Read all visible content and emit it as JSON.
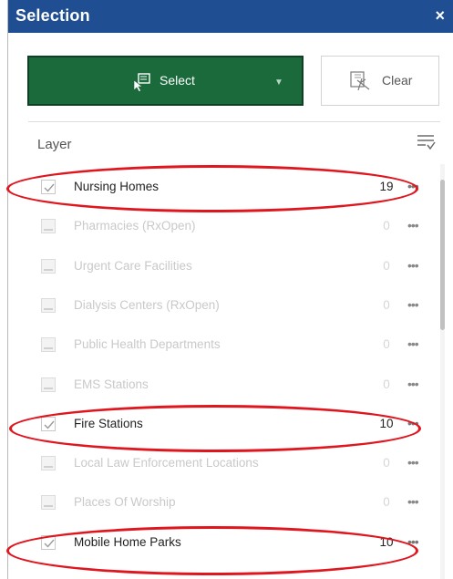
{
  "panel": {
    "title": "Selection",
    "close_glyph": "×"
  },
  "toolbar": {
    "select_label": "Select",
    "select_caret": "▼",
    "clear_label": "Clear"
  },
  "layer_header": "Layer",
  "layers": [
    {
      "name": "Nursing Homes",
      "count": "19",
      "checked": true,
      "active": true
    },
    {
      "name": "Pharmacies (RxOpen)",
      "count": "0",
      "checked": false,
      "active": false
    },
    {
      "name": "Urgent Care Facilities",
      "count": "0",
      "checked": false,
      "active": false
    },
    {
      "name": "Dialysis Centers (RxOpen)",
      "count": "0",
      "checked": false,
      "active": false
    },
    {
      "name": "Public Health Departments",
      "count": "0",
      "checked": false,
      "active": false
    },
    {
      "name": "EMS Stations",
      "count": "0",
      "checked": false,
      "active": false
    },
    {
      "name": "Fire Stations",
      "count": "10",
      "checked": true,
      "active": true
    },
    {
      "name": "Local Law Enforcement Locations",
      "count": "0",
      "checked": false,
      "active": false
    },
    {
      "name": "Places Of Worship",
      "count": "0",
      "checked": false,
      "active": false
    },
    {
      "name": "Mobile Home Parks",
      "count": "10",
      "checked": true,
      "active": true
    }
  ],
  "more_glyph": "•••",
  "colors": {
    "titlebar": "#1f4e93",
    "select_button": "#1a6a3c",
    "annotation": "#e0161f"
  },
  "icons": [
    "select-pointer-icon",
    "clear-icon",
    "filter-list-icon",
    "checkbox-icon",
    "more-options-icon",
    "close-icon"
  ]
}
